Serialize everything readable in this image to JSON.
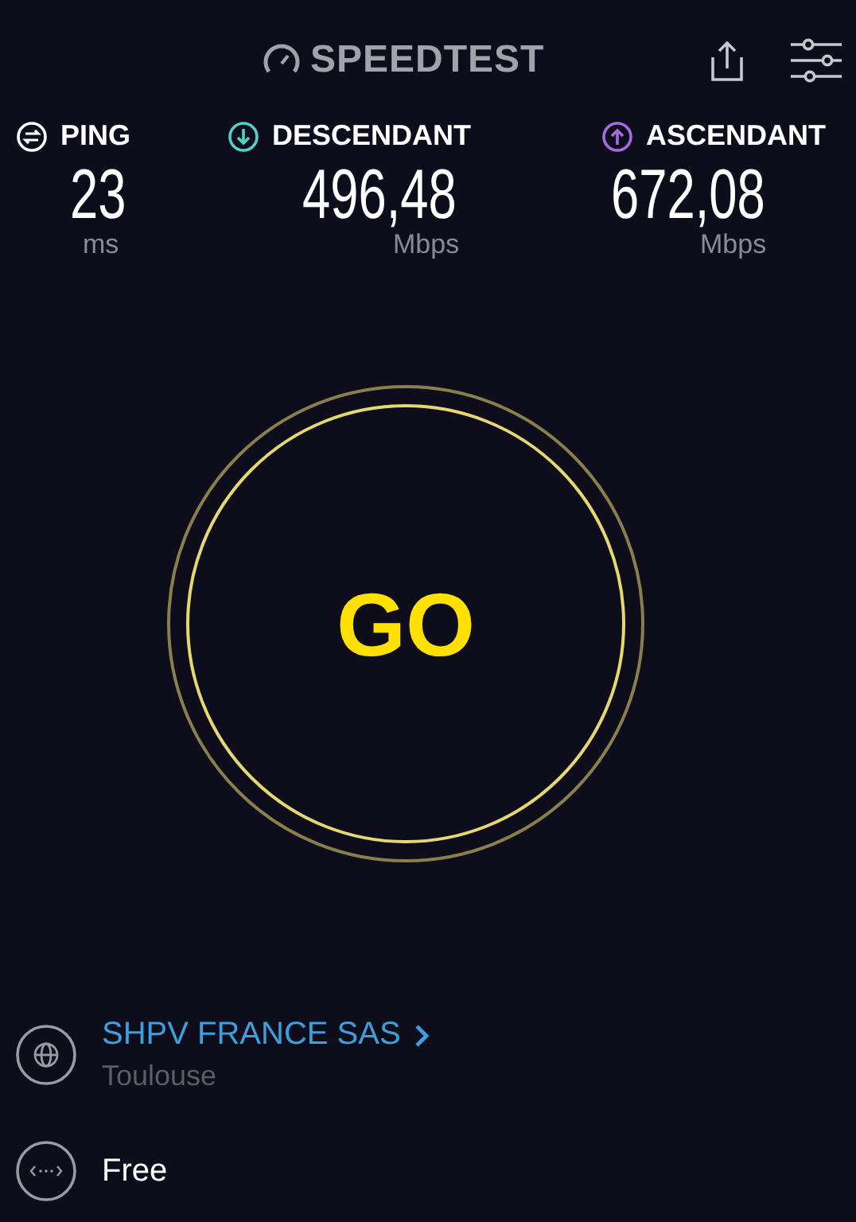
{
  "header": {
    "logo": "SPEEDTEST"
  },
  "metrics": [
    {
      "kind": "ping",
      "label": "PING",
      "value": "23",
      "unit": "ms"
    },
    {
      "kind": "download",
      "label": "DESCENDANT",
      "value": "496,48",
      "unit": "Mbps"
    },
    {
      "kind": "upload",
      "label": "ASCENDANT",
      "value": "672,08",
      "unit": "Mbps"
    }
  ],
  "go_button": {
    "label": "GO"
  },
  "server": {
    "name": "SHPV FRANCE SAS",
    "location": "Toulouse"
  },
  "provider": {
    "name": "Free"
  }
}
